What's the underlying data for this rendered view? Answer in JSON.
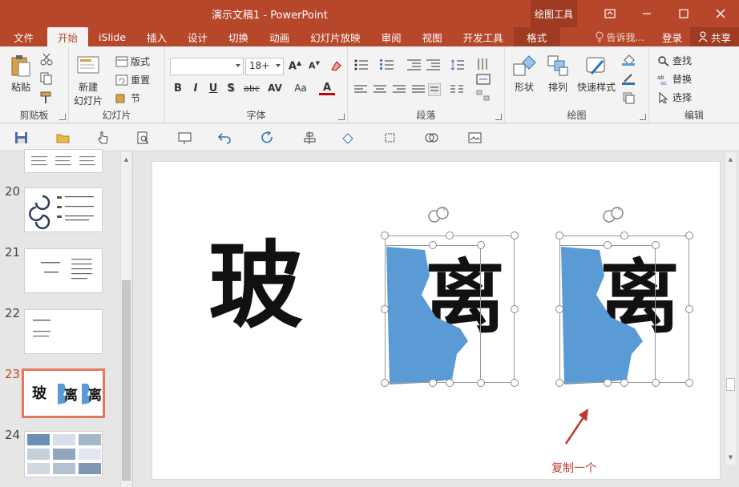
{
  "window": {
    "title": "演示文稿1 - PowerPoint",
    "context_tab_group": "绘图工具",
    "controls": [
      "restore-ribbon-icon",
      "minimize-icon",
      "maximize-icon",
      "close-icon"
    ]
  },
  "tabs": [
    {
      "label": "文件",
      "active": false
    },
    {
      "label": "开始",
      "active": true
    },
    {
      "label": "iSlide",
      "active": false
    },
    {
      "label": "插入",
      "active": false
    },
    {
      "label": "设计",
      "active": false
    },
    {
      "label": "切换",
      "active": false
    },
    {
      "label": "动画",
      "active": false
    },
    {
      "label": "幻灯片放映",
      "active": false
    },
    {
      "label": "审阅",
      "active": false
    },
    {
      "label": "视图",
      "active": false
    },
    {
      "label": "开发工具",
      "active": false
    },
    {
      "label": "格式",
      "active": false
    }
  ],
  "tell_me": "告诉我...",
  "login": "登录",
  "share": "共享",
  "ribbon": {
    "clipboard": {
      "label": "剪贴板",
      "paste": "粘贴"
    },
    "slides": {
      "label": "幻灯片",
      "new_slide": "新建",
      "new_slide_sub": "幻灯片",
      "layout": "版式",
      "reset": "重置",
      "section": "节"
    },
    "font": {
      "label": "字体",
      "font_name": "",
      "font_size": "18+",
      "bold": "B",
      "italic": "I",
      "underline": "U",
      "shadow": "S",
      "strike": "abc",
      "spacing": "AV",
      "case": "Aa"
    },
    "paragraph": {
      "label": "段落"
    },
    "drawing": {
      "label": "绘图",
      "shapes": "形状",
      "arrange": "排列",
      "quick_styles": "快速样式"
    },
    "editing": {
      "label": "编辑",
      "find": "查找",
      "replace": "替换",
      "select": "选择"
    }
  },
  "thumbnails": [
    {
      "number": "20",
      "active": false
    },
    {
      "number": "21",
      "active": false
    },
    {
      "number": "22",
      "active": false
    },
    {
      "number": "23",
      "active": true
    },
    {
      "number": "24",
      "active": false
    }
  ],
  "thumb23": {
    "c1": "玻",
    "c2": "离",
    "c3": "离"
  },
  "slide": {
    "char_left": "玻",
    "char_right_1": "离",
    "char_right_2": "离",
    "annotation": "复制一个"
  },
  "colors": {
    "accent": "#b7472a",
    "shape_fill": "#5b9bd5",
    "annotation": "#c0392b"
  }
}
